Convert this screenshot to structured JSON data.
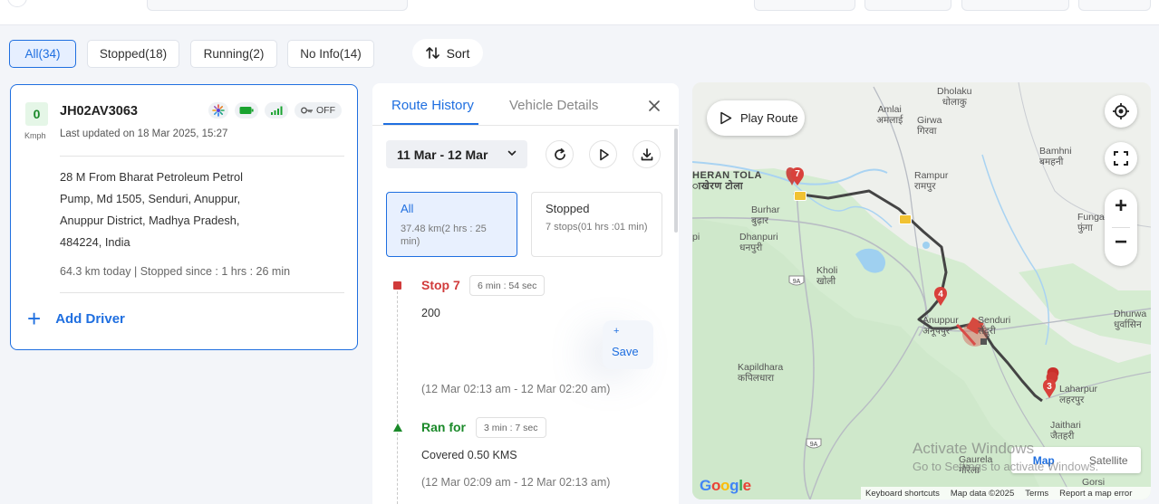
{
  "filters": {
    "all": "All(34)",
    "stopped": "Stopped(18)",
    "running": "Running(2)",
    "no_info": "No Info(14)",
    "sort": "Sort"
  },
  "vehicle": {
    "speed": "0",
    "speed_unit": "Kmph",
    "number": "JH02AV3063",
    "last_updated": "Last updated on 18 Mar 2025, 15:27",
    "ignition": "OFF",
    "address_lines": [
      "28 M From Bharat Petroleum Petrol",
      "Pump, Md 1505, Senduri, Anuppur,",
      "Anuppur District, Madhya Pradesh,",
      "484224, India"
    ],
    "km_today": "64.3 km today | Stopped since : 1 hrs : 26 min",
    "add_driver": "Add Driver",
    "status_color": "#1b8a2a"
  },
  "panel": {
    "tab_route_history": "Route History",
    "tab_vehicle_details": "Vehicle Details",
    "date_range": "11 Mar - 12 Mar",
    "summary_all_title": "All",
    "summary_all_sub": "37.48 km(2 hrs : 25 min)",
    "summary_stopped_title": "Stopped",
    "summary_stopped_sub": "7 stops(01 hrs :01 min)",
    "events": [
      {
        "title": "Stop 7",
        "duration": "6 min : 54 sec",
        "detail": "200",
        "time": "(12 Mar 02:13 am - 12 Mar 02:20 am)"
      },
      {
        "title": "Ran for",
        "duration": "3 min : 7 sec",
        "detail": "Covered 0.50 KMS",
        "time": "(12 Mar 02:09 am - 12 Mar 02:13 am)"
      }
    ],
    "save_plus": "+",
    "save_label": "Save"
  },
  "map": {
    "play_route": "Play Route",
    "map_type_map": "Map",
    "map_type_satellite": "Satellite",
    "google": "Google",
    "attrib_shortcuts": "Keyboard shortcuts",
    "attrib_data": "Map data ©2025",
    "attrib_terms": "Terms",
    "attrib_report": "Report a map error",
    "watermark_1": "Activate Windows",
    "watermark_2": "Go to Settings to activate Windows.",
    "marker_7": "7",
    "marker_4": "4",
    "marker_3": "3",
    "road_9a_1": "9A",
    "road_9a_2": "9A",
    "places": {
      "dholaku": "Dholaku",
      "dholaku_hi": "धोलाकु",
      "amlai": "Amlai",
      "amlai_hi": "अमलाई",
      "girwa": "Girwa",
      "girwa_hi": "गिरवा",
      "bamhni": "Bamhni",
      "bamhni_hi": "बमहनी",
      "kheran_tola": "HERAN TOLA",
      "kheran_tola_hi": "ाखेरण टोला",
      "rampur": "Rampur",
      "rampur_hi": "रामपुर",
      "burhar": "Burhar",
      "burhar_hi": "बुढ़ार",
      "fungar": "Fungar",
      "fungar_hi": "फुंगा",
      "dhanpuri": "Dhanpuri",
      "dhanpuri_hi": "धनपुरी",
      "kholi": "Kholi",
      "kholi_hi": "खोली",
      "anuppur": "Anuppur",
      "anuppur_hi": "अनूपपुर",
      "senduri": "Senduri",
      "senduri_hi": "सेंदुरी",
      "dhurwa": "Dhurwa",
      "dhurwa_hi": "धुर्वासिन",
      "kapildhara": "Kapildhara",
      "kapildhara_hi": "कपिलधारा",
      "laharpur": "Laharpur",
      "laharpur_hi": "लहरपुर",
      "jaithari": "Jaithari",
      "jaithari_hi": "जैतहरी",
      "gaurela": "Gaurela",
      "gaurela_hi": "गौरेला",
      "gorsi": "Gorsi",
      "pi": "pi"
    }
  }
}
